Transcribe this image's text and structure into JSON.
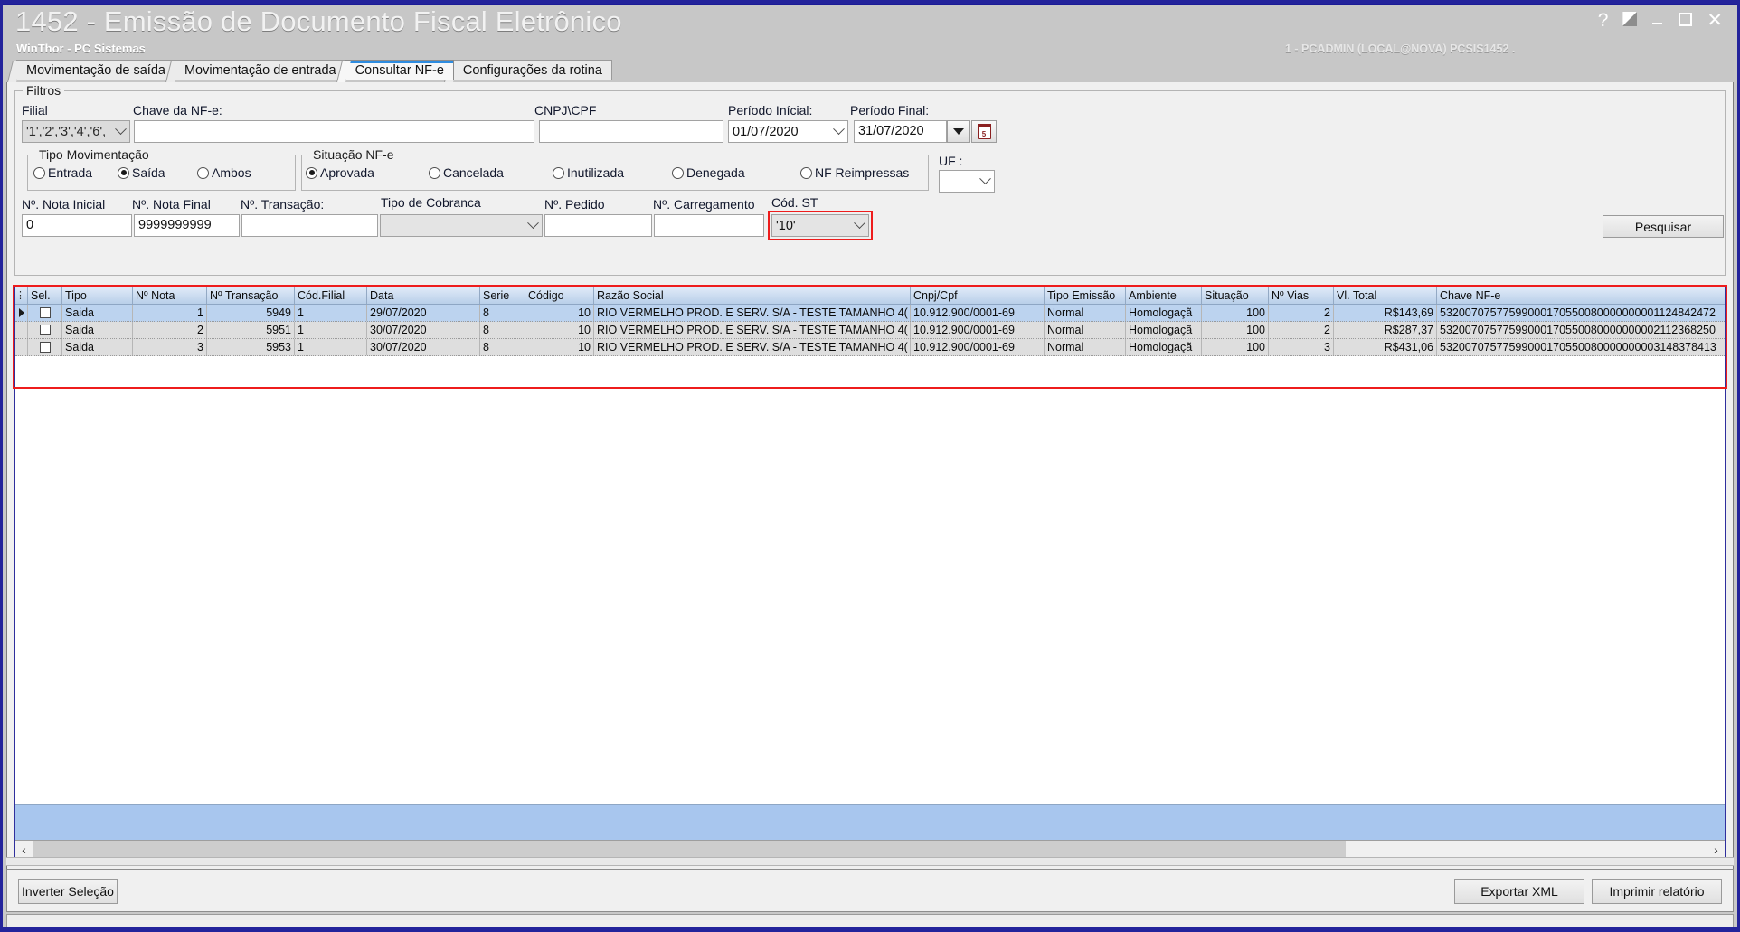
{
  "window": {
    "title": "1452 - Emissão de Documento Fiscal Eletrônico",
    "subtitle": "WinThor - PC Sistemas",
    "session": "1 - PCADMIN (LOCAL@NOVA)   PCSIS1452 .",
    "help_glyph": "?",
    "restore_glyph": "restore-icon",
    "minimize_glyph": "minimize-icon",
    "maximize_glyph": "maximize-icon",
    "close_glyph": "✕"
  },
  "tabs": [
    {
      "label": "Movimentação de saída",
      "active": false
    },
    {
      "label": "Movimentação de entrada",
      "active": false
    },
    {
      "label": "Consultar NF-e",
      "active": true
    },
    {
      "label": "Configurações da rotina",
      "active": false
    }
  ],
  "filters": {
    "group_title": "Filtros",
    "filial": {
      "label": "Filial",
      "value": "'1','2','3','4','6',"
    },
    "chave": {
      "label": "Chave da NF-e:",
      "value": ""
    },
    "cnpj": {
      "label": "CNPJ\\CPF",
      "value": ""
    },
    "periodo_inicial": {
      "label": "Período Inícial:",
      "value": "01/07/2020"
    },
    "periodo_final": {
      "label": "Período Final:",
      "value": "31/07/2020"
    },
    "calendar_icon": "calendar-icon",
    "calendar_day": "5",
    "uf": {
      "label": "UF :",
      "value": ""
    },
    "tipo_movimentacao": {
      "group_title": "Tipo Movimentação",
      "options": [
        {
          "label": "Entrada",
          "checked": false
        },
        {
          "label": "Saída",
          "checked": true
        },
        {
          "label": "Ambos",
          "checked": false
        }
      ]
    },
    "situacao_nfe": {
      "group_title": "Situação NF-e",
      "options": [
        {
          "label": "Aprovada",
          "checked": true
        },
        {
          "label": "Cancelada",
          "checked": false
        },
        {
          "label": "Inutilizada",
          "checked": false
        },
        {
          "label": "Denegada",
          "checked": false
        },
        {
          "label": "NF Reimpressas",
          "checked": false
        }
      ]
    },
    "nota_inicial": {
      "label": "Nº. Nota Inicial",
      "value": "0"
    },
    "nota_final": {
      "label": "Nº. Nota Final",
      "value": "9999999999"
    },
    "transacao": {
      "label": "Nº. Transação:",
      "value": ""
    },
    "tipo_cobranca": {
      "label": "Tipo de Cobranca",
      "value": ""
    },
    "pedido": {
      "label": "Nº. Pedido",
      "value": ""
    },
    "carregamento": {
      "label": "Nº. Carregamento",
      "value": ""
    },
    "cod_st": {
      "label": "Cód. ST",
      "value": "'10'"
    },
    "pesquisar_label": "Pesquisar"
  },
  "grid": {
    "columns": [
      "Sel.",
      "Tipo",
      "Nº Nota",
      "Nº Transação",
      "Cód.Filial",
      "Data",
      "Serie",
      "Código",
      "Razão Social",
      "Cnpj/Cpf",
      "Tipo Emissão",
      "Ambiente",
      "Situação",
      "Nº Vias",
      "Vl. Total",
      "Chave NF-e"
    ],
    "rows": [
      {
        "selected": false,
        "tipo": "Saida",
        "num_nota": "1",
        "num_transacao": "5949",
        "cod_filial": "1",
        "data": "29/07/2020",
        "serie": "8",
        "codigo": "10",
        "razao_social": "RIO VERMELHO PROD. E SERV. S/A - TESTE TAMANHO 4(",
        "cnpj_cpf": "10.912.900/0001-69",
        "tipo_emissao": "Normal",
        "ambiente": "Homologaçã",
        "situacao": "100",
        "num_vias": "2",
        "vl_total": "R$143,69",
        "chave": "53200707577599000170550080000000001124842472"
      },
      {
        "selected": false,
        "tipo": "Saida",
        "num_nota": "2",
        "num_transacao": "5951",
        "cod_filial": "1",
        "data": "30/07/2020",
        "serie": "8",
        "codigo": "10",
        "razao_social": "RIO VERMELHO PROD. E SERV. S/A - TESTE TAMANHO 4(",
        "cnpj_cpf": "10.912.900/0001-69",
        "tipo_emissao": "Normal",
        "ambiente": "Homologaçã",
        "situacao": "100",
        "num_vias": "2",
        "vl_total": "R$287,37",
        "chave": "53200707577599000170550080000000002112368250"
      },
      {
        "selected": false,
        "tipo": "Saida",
        "num_nota": "3",
        "num_transacao": "5953",
        "cod_filial": "1",
        "data": "30/07/2020",
        "serie": "8",
        "codigo": "10",
        "razao_social": "RIO VERMELHO PROD. E SERV. S/A - TESTE TAMANHO 4(",
        "cnpj_cpf": "10.912.900/0001-69",
        "tipo_emissao": "Normal",
        "ambiente": "Homologaçã",
        "situacao": "100",
        "num_vias": "3",
        "vl_total": "R$431,06",
        "chave": "53200707577599000170550080000000003148378413"
      }
    ]
  },
  "footer": {
    "inverter_label": "Inverter Seleção",
    "exportar_label": "Exportar XML",
    "imprimir_label": "Imprimir relatório"
  },
  "colors": {
    "title_blue": "#23239b",
    "accent_tab": "#2e8ce0",
    "highlight_red": "#ee1c1c",
    "grid_header": "#b9cfe9",
    "row_selected": "#bcd3ef"
  }
}
